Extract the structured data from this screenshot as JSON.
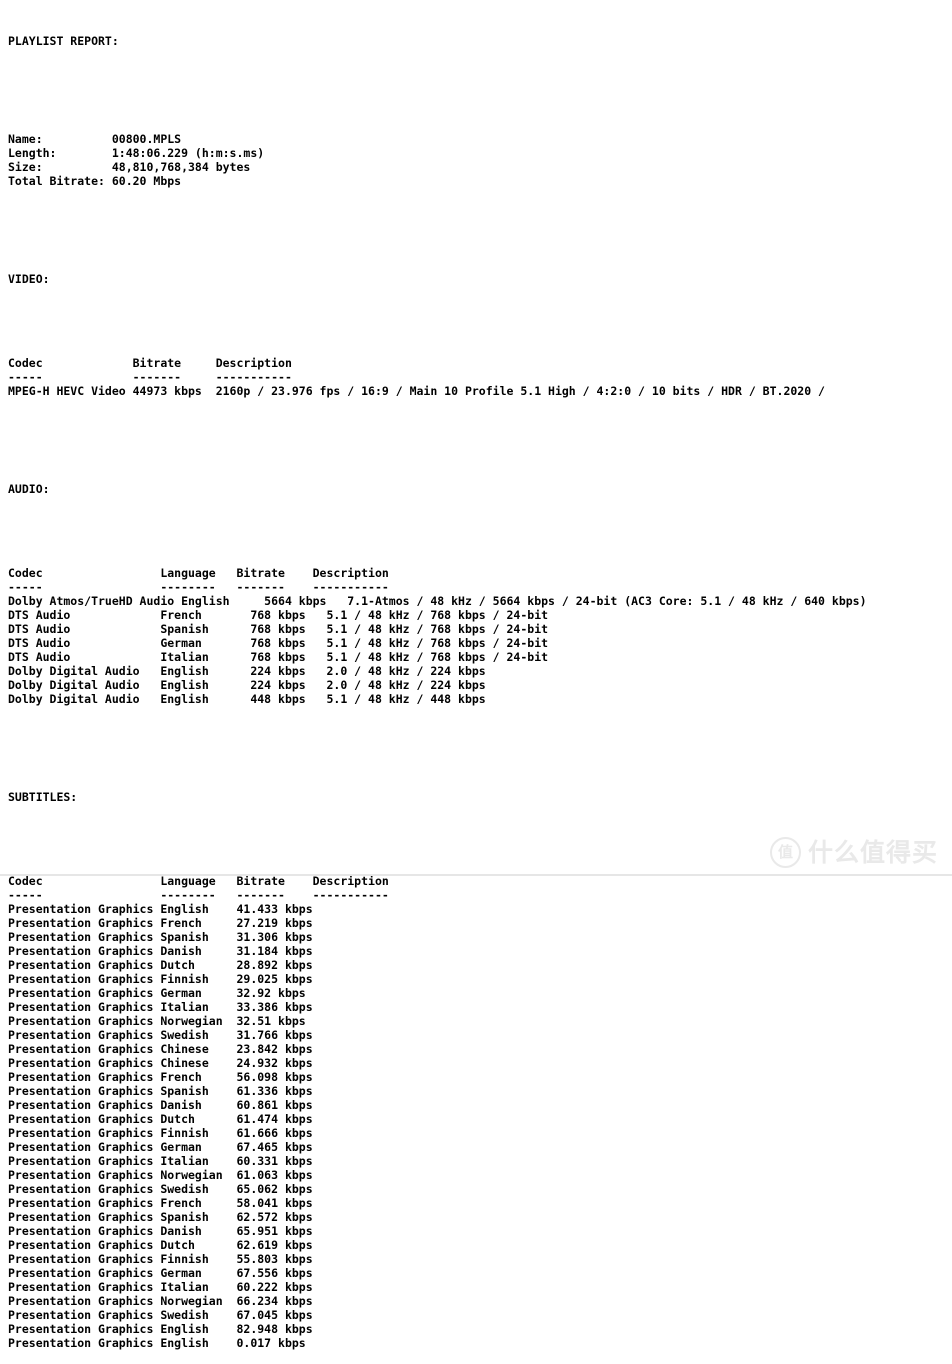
{
  "report": {
    "title": "PLAYLIST REPORT:",
    "summary": {
      "fields": [
        {
          "label": "Name:",
          "value": "00800.MPLS"
        },
        {
          "label": "Length:",
          "value": "1:48:06.229 (h:m:s.ms)"
        },
        {
          "label": "Size:",
          "value": "48,810,768,384 bytes"
        },
        {
          "label": "Total Bitrate:",
          "value": "60.20 Mbps"
        }
      ]
    },
    "video": {
      "title": "VIDEO:",
      "headers": {
        "codec": "Codec",
        "bitrate": "Bitrate",
        "description": "Description"
      },
      "rules": {
        "codec": "-----",
        "bitrate": "-------",
        "description": "-----------"
      },
      "rows": [
        {
          "codec": "MPEG-H HEVC Video",
          "bitrate": "44973 kbps",
          "description": "2160p / 23.976 fps / 16:9 / Main 10 Profile 5.1 High / 4:2:0 / 10 bits / HDR / BT.2020 /"
        }
      ]
    },
    "audio": {
      "title": "AUDIO:",
      "headers": {
        "codec": "Codec",
        "language": "Language",
        "bitrate": "Bitrate",
        "description": "Description"
      },
      "rules": {
        "codec": "-----",
        "language": "--------",
        "bitrate": "-------",
        "description": "-----------"
      },
      "rows": [
        {
          "codec": "Dolby Atmos/TrueHD Audio",
          "language": "English",
          "bitrate": "5664 kbps",
          "description": "7.1-Atmos / 48 kHz / 5664 kbps / 24-bit (AC3 Core: 5.1 / 48 kHz / 640 kbps)"
        },
        {
          "codec": "DTS Audio",
          "language": "French",
          "bitrate": "768 kbps",
          "description": "5.1 / 48 kHz / 768 kbps / 24-bit"
        },
        {
          "codec": "DTS Audio",
          "language": "Spanish",
          "bitrate": "768 kbps",
          "description": "5.1 / 48 kHz / 768 kbps / 24-bit"
        },
        {
          "codec": "DTS Audio",
          "language": "German",
          "bitrate": "768 kbps",
          "description": "5.1 / 48 kHz / 768 kbps / 24-bit"
        },
        {
          "codec": "DTS Audio",
          "language": "Italian",
          "bitrate": "768 kbps",
          "description": "5.1 / 48 kHz / 768 kbps / 24-bit"
        },
        {
          "codec": "Dolby Digital Audio",
          "language": "English",
          "bitrate": "224 kbps",
          "description": "2.0 / 48 kHz / 224 kbps"
        },
        {
          "codec": "Dolby Digital Audio",
          "language": "English",
          "bitrate": "224 kbps",
          "description": "2.0 / 48 kHz / 224 kbps"
        },
        {
          "codec": "Dolby Digital Audio",
          "language": "English",
          "bitrate": "448 kbps",
          "description": "5.1 / 48 kHz / 448 kbps"
        }
      ]
    },
    "subtitles": {
      "title": "SUBTITLES:",
      "headers": {
        "codec": "Codec",
        "language": "Language",
        "bitrate": "Bitrate",
        "description": "Description"
      },
      "rules": {
        "codec": "-----",
        "language": "--------",
        "bitrate": "-------",
        "description": "-----------"
      },
      "rows": [
        {
          "codec": "Presentation Graphics",
          "language": "English",
          "bitrate": "41.433 kbps",
          "description": ""
        },
        {
          "codec": "Presentation Graphics",
          "language": "French",
          "bitrate": "27.219 kbps",
          "description": ""
        },
        {
          "codec": "Presentation Graphics",
          "language": "Spanish",
          "bitrate": "31.306 kbps",
          "description": ""
        },
        {
          "codec": "Presentation Graphics",
          "language": "Danish",
          "bitrate": "31.184 kbps",
          "description": ""
        },
        {
          "codec": "Presentation Graphics",
          "language": "Dutch",
          "bitrate": "28.892 kbps",
          "description": ""
        },
        {
          "codec": "Presentation Graphics",
          "language": "Finnish",
          "bitrate": "29.025 kbps",
          "description": ""
        },
        {
          "codec": "Presentation Graphics",
          "language": "German",
          "bitrate": "32.92 kbps",
          "description": ""
        },
        {
          "codec": "Presentation Graphics",
          "language": "Italian",
          "bitrate": "33.386 kbps",
          "description": ""
        },
        {
          "codec": "Presentation Graphics",
          "language": "Norwegian",
          "bitrate": "32.51 kbps",
          "description": ""
        },
        {
          "codec": "Presentation Graphics",
          "language": "Swedish",
          "bitrate": "31.766 kbps",
          "description": ""
        },
        {
          "codec": "Presentation Graphics",
          "language": "Chinese",
          "bitrate": "23.842 kbps",
          "description": ""
        },
        {
          "codec": "Presentation Graphics",
          "language": "Chinese",
          "bitrate": "24.932 kbps",
          "description": ""
        },
        {
          "codec": "Presentation Graphics",
          "language": "French",
          "bitrate": "56.098 kbps",
          "description": ""
        },
        {
          "codec": "Presentation Graphics",
          "language": "Spanish",
          "bitrate": "61.336 kbps",
          "description": ""
        },
        {
          "codec": "Presentation Graphics",
          "language": "Danish",
          "bitrate": "60.861 kbps",
          "description": ""
        },
        {
          "codec": "Presentation Graphics",
          "language": "Dutch",
          "bitrate": "61.474 kbps",
          "description": ""
        },
        {
          "codec": "Presentation Graphics",
          "language": "Finnish",
          "bitrate": "61.666 kbps",
          "description": ""
        },
        {
          "codec": "Presentation Graphics",
          "language": "German",
          "bitrate": "67.465 kbps",
          "description": ""
        },
        {
          "codec": "Presentation Graphics",
          "language": "Italian",
          "bitrate": "60.331 kbps",
          "description": ""
        },
        {
          "codec": "Presentation Graphics",
          "language": "Norwegian",
          "bitrate": "61.063 kbps",
          "description": ""
        },
        {
          "codec": "Presentation Graphics",
          "language": "Swedish",
          "bitrate": "65.062 kbps",
          "description": ""
        },
        {
          "codec": "Presentation Graphics",
          "language": "French",
          "bitrate": "58.041 kbps",
          "description": ""
        },
        {
          "codec": "Presentation Graphics",
          "language": "Spanish",
          "bitrate": "62.572 kbps",
          "description": ""
        },
        {
          "codec": "Presentation Graphics",
          "language": "Danish",
          "bitrate": "65.951 kbps",
          "description": ""
        },
        {
          "codec": "Presentation Graphics",
          "language": "Dutch",
          "bitrate": "62.619 kbps",
          "description": ""
        },
        {
          "codec": "Presentation Graphics",
          "language": "Finnish",
          "bitrate": "55.803 kbps",
          "description": ""
        },
        {
          "codec": "Presentation Graphics",
          "language": "German",
          "bitrate": "67.556 kbps",
          "description": ""
        },
        {
          "codec": "Presentation Graphics",
          "language": "Italian",
          "bitrate": "60.222 kbps",
          "description": ""
        },
        {
          "codec": "Presentation Graphics",
          "language": "Norwegian",
          "bitrate": "66.234 kbps",
          "description": ""
        },
        {
          "codec": "Presentation Graphics",
          "language": "Swedish",
          "bitrate": "67.045 kbps",
          "description": ""
        },
        {
          "codec": "Presentation Graphics",
          "language": "English",
          "bitrate": "82.948 kbps",
          "description": ""
        },
        {
          "codec": "Presentation Graphics",
          "language": "English",
          "bitrate": "0.017 kbps",
          "description": ""
        }
      ]
    }
  },
  "watermark": {
    "badge": "值",
    "text": "什么值得买",
    "color": "#e9e9e9"
  },
  "layout": {
    "summary_label_width": 15,
    "video_cols": {
      "codec": 0,
      "bitrate": 18,
      "description": 30
    },
    "audio_cols": {
      "codec": 0,
      "language": 22,
      "bitrate": 33,
      "description": 44
    },
    "subtitle_cols": {
      "codec": 0,
      "language": 22,
      "bitrate": 33,
      "description": 44
    },
    "bitrate_field_width": 10
  }
}
